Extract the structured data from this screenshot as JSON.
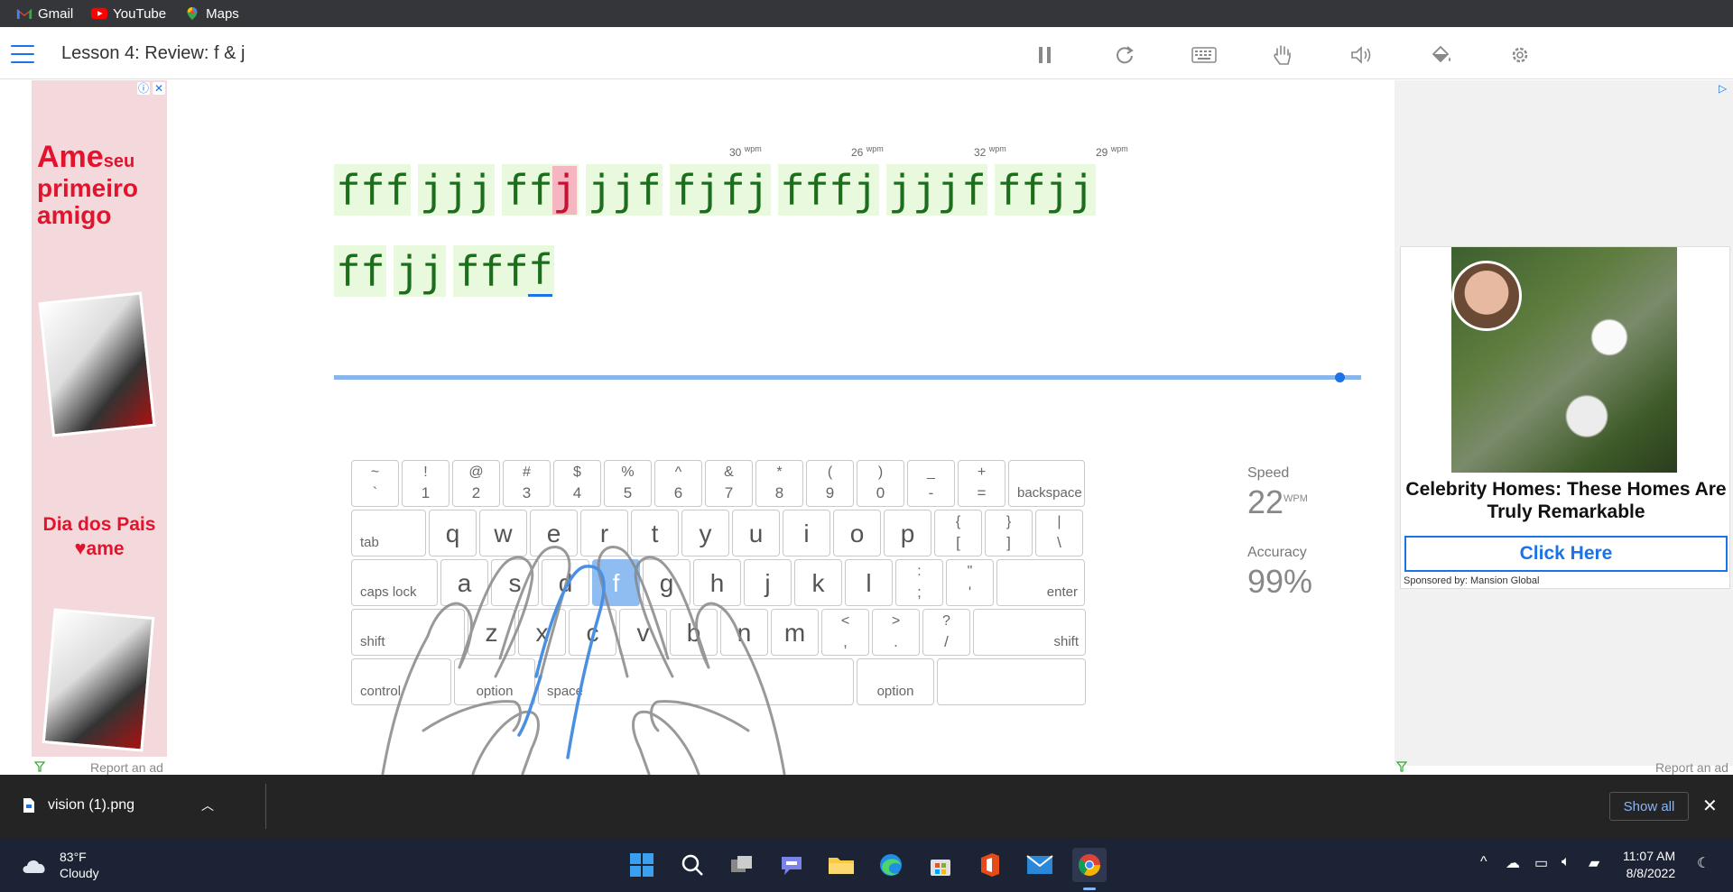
{
  "bookmarks": [
    {
      "label": "Gmail"
    },
    {
      "label": "YouTube"
    },
    {
      "label": "Maps"
    }
  ],
  "lesson": {
    "title": "Lesson 4: Review: f & j"
  },
  "typing": {
    "line1": [
      "fff",
      "jjj",
      "ffj",
      "jjf",
      "fjfj",
      "fffj",
      "jjjf",
      "ffjj"
    ],
    "line2": [
      "ff",
      "jj",
      "ffff"
    ],
    "wpm_markers": [
      {
        "value": "30",
        "unit": "wpm"
      },
      {
        "value": "26",
        "unit": "wpm"
      },
      {
        "value": "32",
        "unit": "wpm"
      },
      {
        "value": "29",
        "unit": "wpm"
      }
    ]
  },
  "progress": {
    "fraction": 0.98
  },
  "keyboard": {
    "row1": [
      [
        "~",
        "`"
      ],
      [
        "!",
        "1"
      ],
      [
        "@",
        "2"
      ],
      [
        "#",
        "3"
      ],
      [
        "$",
        "4"
      ],
      [
        "%",
        "5"
      ],
      [
        "^",
        "6"
      ],
      [
        "&",
        "7"
      ],
      [
        "*",
        "8"
      ],
      [
        "(",
        "9"
      ],
      [
        ")",
        "0"
      ],
      [
        "_",
        "-"
      ],
      [
        "+",
        "="
      ]
    ],
    "backspace": "backspace",
    "tab": "tab",
    "row2": [
      "q",
      "w",
      "e",
      "r",
      "t",
      "y",
      "u",
      "i",
      "o",
      "p"
    ],
    "row2_sym": [
      [
        "{",
        "["
      ],
      [
        "}",
        "]"
      ],
      [
        "|",
        "\\"
      ]
    ],
    "caps": "caps lock",
    "row3": [
      "a",
      "s",
      "d",
      "f",
      "g",
      "h",
      "j",
      "k",
      "l"
    ],
    "row3_sym": [
      [
        ":",
        ";"
      ],
      [
        "\"",
        "'"
      ]
    ],
    "enter": "enter",
    "shift_left": "shift",
    "row4": [
      "z",
      "x",
      "c",
      "v",
      "b",
      "n",
      "m"
    ],
    "row4_sym": [
      [
        "<",
        ","
      ],
      [
        ">",
        "."
      ],
      [
        "?",
        "/"
      ]
    ],
    "shift_right": "shift",
    "control": "control",
    "option_left": "option",
    "space": "space",
    "option_right": "option",
    "highlight": "f"
  },
  "stats": {
    "speed_label": "Speed",
    "speed_value": "22",
    "speed_unit": "WPM",
    "accuracy_label": "Accuracy",
    "accuracy_value": "99%"
  },
  "ads": {
    "left": {
      "brand_line1": "Ame",
      "brand_seu": "seu",
      "brand_line2": "primeiro",
      "brand_line3": "amigo",
      "dia_line1": "Dia dos Pais",
      "dia_line2": "ame",
      "report": "Report an ad"
    },
    "right": {
      "headline": "Celebrity Homes: These Homes Are Truly Remarkable",
      "cta": "Click Here",
      "sponsor": "Sponsored by: Mansion Global",
      "report": "Report an ad"
    }
  },
  "download": {
    "filename": "vision (1).png",
    "show_all": "Show all"
  },
  "taskbar": {
    "temp": "83°F",
    "condition": "Cloudy",
    "time": "11:07 AM",
    "date": "8/8/2022"
  },
  "colors": {
    "accent": "#1a73e8",
    "typed_green": "#1c6e1c",
    "word_bg": "#e8f9de",
    "error_bg": "#f6b6c1"
  }
}
